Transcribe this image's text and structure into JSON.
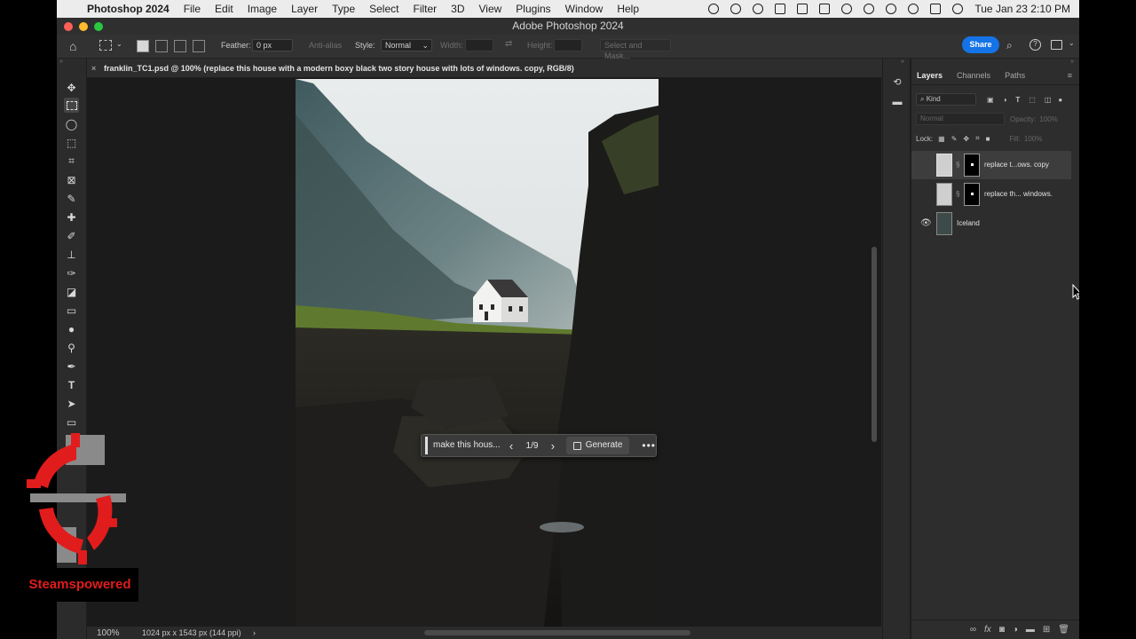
{
  "menubar": {
    "app_name": "Photoshop 2024",
    "items": [
      "File",
      "Edit",
      "Image",
      "Layer",
      "Type",
      "Select",
      "Filter",
      "3D",
      "View",
      "Plugins",
      "Window",
      "Help"
    ],
    "datetime": "Tue Jan 23  2:10 PM"
  },
  "window": {
    "title": "Adobe Photoshop 2024"
  },
  "options_bar": {
    "feather_label": "Feather:",
    "feather_value": "0 px",
    "antialias_label": "Anti-alias",
    "style_label": "Style:",
    "style_value": "Normal",
    "width_label": "Width:",
    "height_label": "Height:",
    "select_mask_label": "Select and Mask...",
    "share_label": "Share"
  },
  "document": {
    "tab_title": "franklin_TC1.psd @ 100% (replace this house with a modern boxy black two story house with lots of windows. copy, RGB/8)"
  },
  "generative_bar": {
    "prompt_text": "make this hous...",
    "variation_count": "1/9",
    "generate_label": "Generate"
  },
  "statusbar": {
    "zoom": "100%",
    "doc_info": "1024 px x 1543 px (144 ppi)"
  },
  "layers_panel": {
    "tabs": [
      "Layers",
      "Channels",
      "Paths"
    ],
    "filter_kind": "Kind",
    "blend_mode": "Normal",
    "opacity_label": "Opacity:",
    "opacity_value": "100%",
    "lock_label": "Lock:",
    "fill_label": "Fill:",
    "fill_value": "100%",
    "layers": [
      {
        "name": "replace t...ows. copy",
        "visible": false,
        "selected": true
      },
      {
        "name": "replace th... windows.",
        "visible": false,
        "selected": false
      },
      {
        "name": "Iceland",
        "visible": true,
        "selected": false
      }
    ]
  },
  "watermark": {
    "text": "Steamspowered"
  },
  "colors": {
    "accent": "#1473e6",
    "watermark_red": "#e11c1c"
  }
}
